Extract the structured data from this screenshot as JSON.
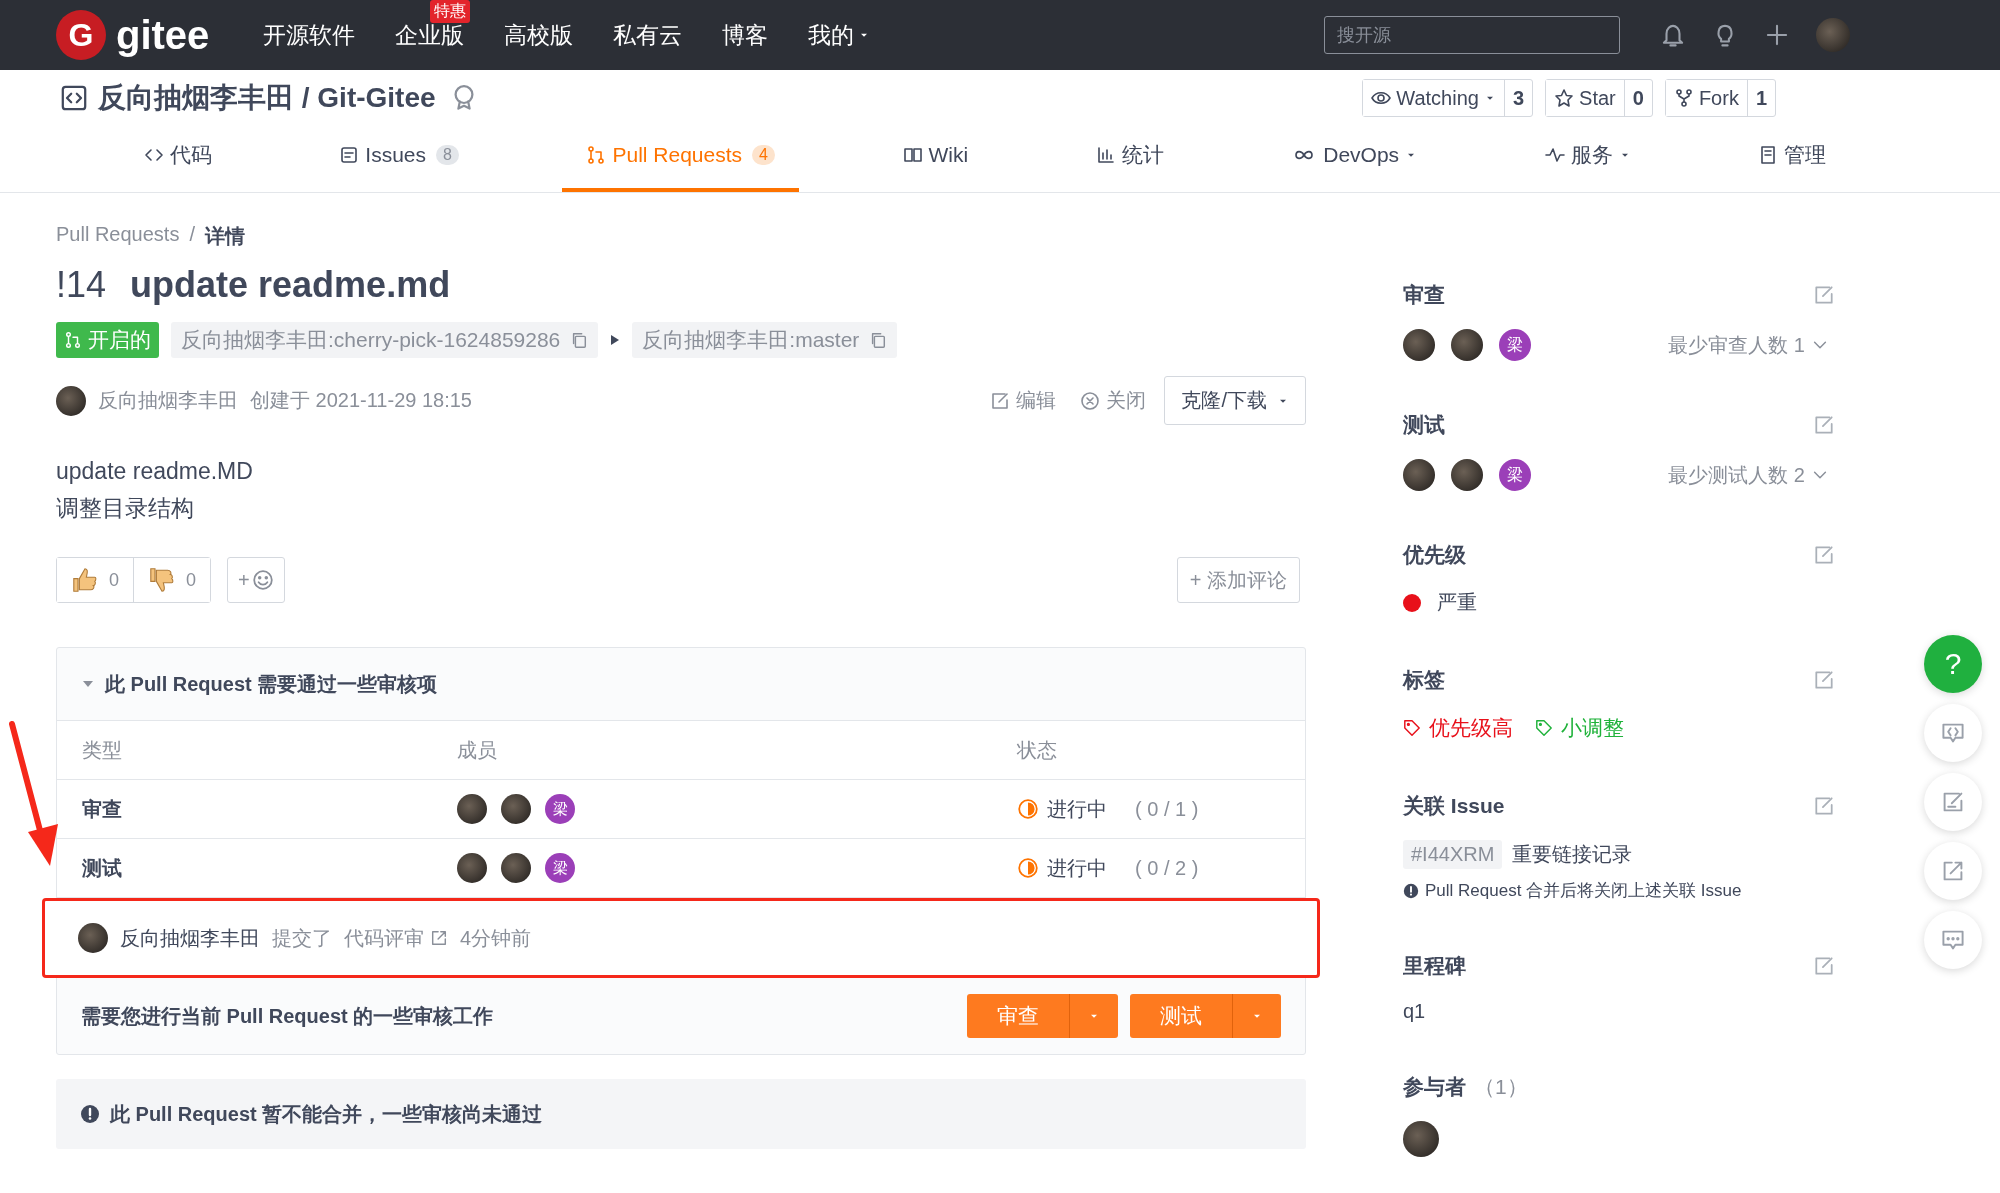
{
  "topbar": {
    "logo_letter": "G",
    "logo_text": "gitee",
    "nav": [
      {
        "label": "开源软件"
      },
      {
        "label": "企业版",
        "badge": "特惠"
      },
      {
        "label": "高校版"
      },
      {
        "label": "私有云"
      },
      {
        "label": "博客"
      },
      {
        "label": "我的",
        "dropdown": true
      }
    ],
    "search": {
      "placeholder": "搜开源"
    }
  },
  "repo": {
    "title": "反向抽烟李丰田 / Git-Gitee",
    "actions": [
      {
        "label": "Watching",
        "count": "3",
        "kind": "watch",
        "dropdown": true
      },
      {
        "label": "Star",
        "count": "0",
        "kind": "star"
      },
      {
        "label": "Fork",
        "count": "1",
        "kind": "fork"
      }
    ]
  },
  "tabs": [
    {
      "label": "代码",
      "kind": "code",
      "selected": false
    },
    {
      "label": "Issues",
      "count": "8",
      "kind": "issues",
      "selected": false
    },
    {
      "label": "Pull Requests",
      "count": "4",
      "kind": "pr",
      "selected": true
    },
    {
      "label": "Wiki",
      "kind": "wiki",
      "selected": false
    },
    {
      "label": "统计",
      "kind": "stats",
      "selected": false
    },
    {
      "label": "DevOps",
      "kind": "devops",
      "dropdown": true,
      "selected": false
    },
    {
      "label": "服务",
      "kind": "service",
      "dropdown": true,
      "selected": false
    },
    {
      "label": "管理",
      "kind": "manage",
      "selected": false
    }
  ],
  "pr": {
    "breadcrumb": [
      "Pull Requests",
      "详情"
    ],
    "breadcrumb_separator": "/",
    "number": "!14",
    "title": "update readme.md",
    "status": "开启的",
    "source": "反向抽烟李丰田:cherry-pick-1624859286",
    "target": "反向抽烟李丰田:master",
    "author": "反向抽烟李丰田",
    "created": "创建于 2021-11-29 18:15",
    "actions": [
      {
        "label": "编辑",
        "kind": "edit"
      },
      {
        "label": "关闭",
        "kind": "close"
      }
    ],
    "clone": "克隆/下载",
    "description": [
      "update readme.MD",
      "调整目录结构"
    ],
    "reactions": [
      {
        "kind": "thumbs-up",
        "count": "0"
      },
      {
        "kind": "thumbs-down",
        "count": "0"
      }
    ],
    "add_reaction": "+",
    "add_comment": "+ 添加评论"
  },
  "checks": {
    "title": "此 Pull Request 需要通过一些审核项",
    "expanded": true,
    "columns": [
      "类型",
      "成员",
      "状态"
    ],
    "rows": [
      {
        "type": "审查",
        "members": [
          {
            "kind": "photo"
          },
          {
            "kind": "photo"
          },
          {
            "kind": "initial",
            "initial": "梁"
          }
        ],
        "status": "进行中",
        "progress": "( 0 / 1 )"
      },
      {
        "type": "测试",
        "members": [
          {
            "kind": "photo"
          },
          {
            "kind": "photo"
          },
          {
            "kind": "initial",
            "initial": "梁"
          }
        ],
        "status": "进行中",
        "progress": "( 0 / 2 )"
      }
    ],
    "activity": {
      "user": "反向抽烟李丰田",
      "action": "提交了",
      "link": "代码评审",
      "time": "4分钟前"
    },
    "footer": "需要您进行当前 Pull Request 的一些审核工作",
    "buttons": [
      "审查",
      "测试"
    ]
  },
  "merge_notice": "此 Pull Request 暂不能合并，一些审核尚未通过",
  "sidebar": [
    {
      "kind": "members",
      "title": "审查",
      "members": [
        {
          "kind": "photo"
        },
        {
          "kind": "photo"
        },
        {
          "kind": "initial",
          "initial": "梁"
        }
      ],
      "setting": "最少审查人数 1"
    },
    {
      "kind": "members",
      "title": "测试",
      "members": [
        {
          "kind": "photo"
        },
        {
          "kind": "photo"
        },
        {
          "kind": "initial",
          "initial": "梁"
        }
      ],
      "setting": "最少测试人数 2"
    },
    {
      "kind": "priority",
      "title": "优先级",
      "label": "严重",
      "color": "#e8101a"
    },
    {
      "kind": "labels",
      "title": "标签",
      "labels": [
        {
          "label": "优先级高",
          "color": "#e8101a"
        },
        {
          "label": "小调整",
          "color": "#1fb23a"
        }
      ]
    },
    {
      "kind": "issues",
      "title": "关联 Issue",
      "issue_id": "#I44XRM",
      "issue_title": "重要链接记录",
      "note": "Pull Request 合并后将关闭上述关联 Issue"
    },
    {
      "kind": "milestone",
      "title": "里程碑",
      "value": "q1"
    },
    {
      "kind": "participants",
      "title": "参与者",
      "count": "（1）",
      "members": [
        {
          "kind": "photo"
        }
      ]
    }
  ],
  "floating": [
    {
      "kind": "help",
      "label": "?"
    },
    {
      "kind": "code"
    },
    {
      "kind": "edit"
    },
    {
      "kind": "share"
    },
    {
      "kind": "comment"
    }
  ]
}
